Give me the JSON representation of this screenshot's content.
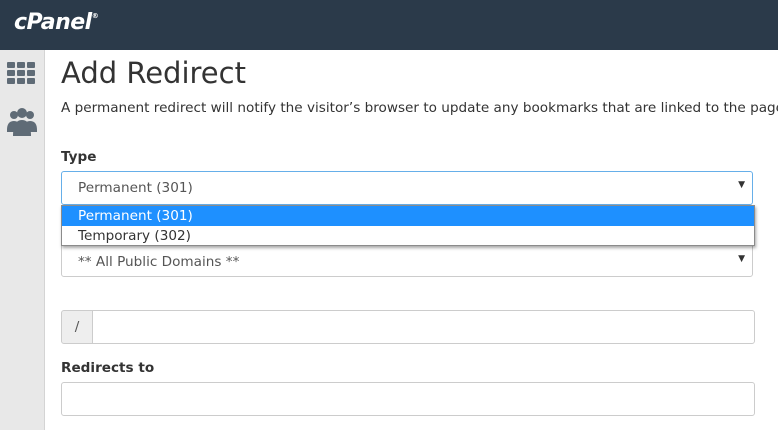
{
  "brand": {
    "logo_text": "cPanel",
    "logo_mark": "®"
  },
  "sidebar": {
    "items": [
      {
        "icon": "grid-icon"
      },
      {
        "icon": "users-icon"
      }
    ]
  },
  "page": {
    "title": "Add Redirect",
    "description": "A permanent redirect will notify the visitor’s browser to update any bookmarks that are linked to the page that"
  },
  "form": {
    "type_label": "Type",
    "type_value": "Permanent (301)",
    "type_options": [
      "Permanent (301)",
      "Temporary (302)"
    ],
    "domain_value": "** All Public Domains **",
    "path_prefix": "/",
    "path_value": "",
    "redirects_to_label": "Redirects to",
    "redirects_to_value": ""
  },
  "colors": {
    "topbar": "#2b3a4a",
    "selected_option": "#1e90ff",
    "focus_border": "#66afe9"
  }
}
